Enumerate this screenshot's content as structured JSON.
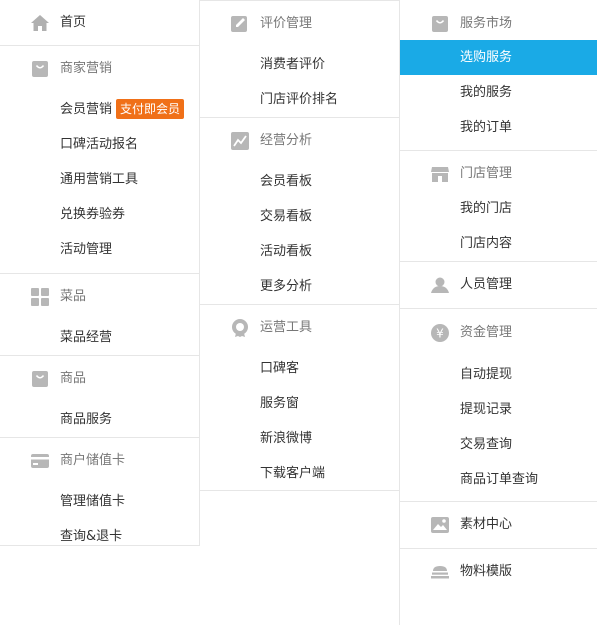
{
  "col1": {
    "home": "首页",
    "merchant_marketing": {
      "title": "商家营销",
      "items": [
        "会员营销",
        "口碑活动报名",
        "通用营销工具",
        "兑换券验券",
        "活动管理"
      ],
      "badge": "支付即会员"
    },
    "dishes": {
      "title": "菜品",
      "items": [
        "菜品经营"
      ]
    },
    "goods": {
      "title": "商品",
      "items": [
        "商品服务"
      ]
    },
    "stored_card": {
      "title": "商户储值卡",
      "items": [
        "管理储值卡",
        "查询&退卡"
      ]
    }
  },
  "col2": {
    "review": {
      "title": "评价管理",
      "items": [
        "消费者评价",
        "门店评价排名"
      ]
    },
    "analysis": {
      "title": "经营分析",
      "items": [
        "会员看板",
        "交易看板",
        "活动看板",
        "更多分析"
      ]
    },
    "ops_tools": {
      "title": "运营工具",
      "items": [
        "口碑客",
        "服务窗",
        "新浪微博",
        "下载客户端"
      ]
    }
  },
  "col3": {
    "service_market": {
      "title": "服务市场",
      "items": [
        "选购服务",
        "我的服务",
        "我的订单"
      ]
    },
    "store_mgmt": {
      "title": "门店管理",
      "items": [
        "我的门店",
        "门店内容"
      ]
    },
    "staff": {
      "title": "人员管理"
    },
    "funds": {
      "title": "资金管理",
      "items": [
        "自动提现",
        "提现记录",
        "交易查询",
        "商品订单查询"
      ]
    },
    "materials": {
      "title": "素材中心"
    },
    "print_templates": {
      "title": "物料模版"
    }
  },
  "colors": {
    "accent": "#1aaae6",
    "badge": "#f07018",
    "icon": "#b7b7b7"
  }
}
